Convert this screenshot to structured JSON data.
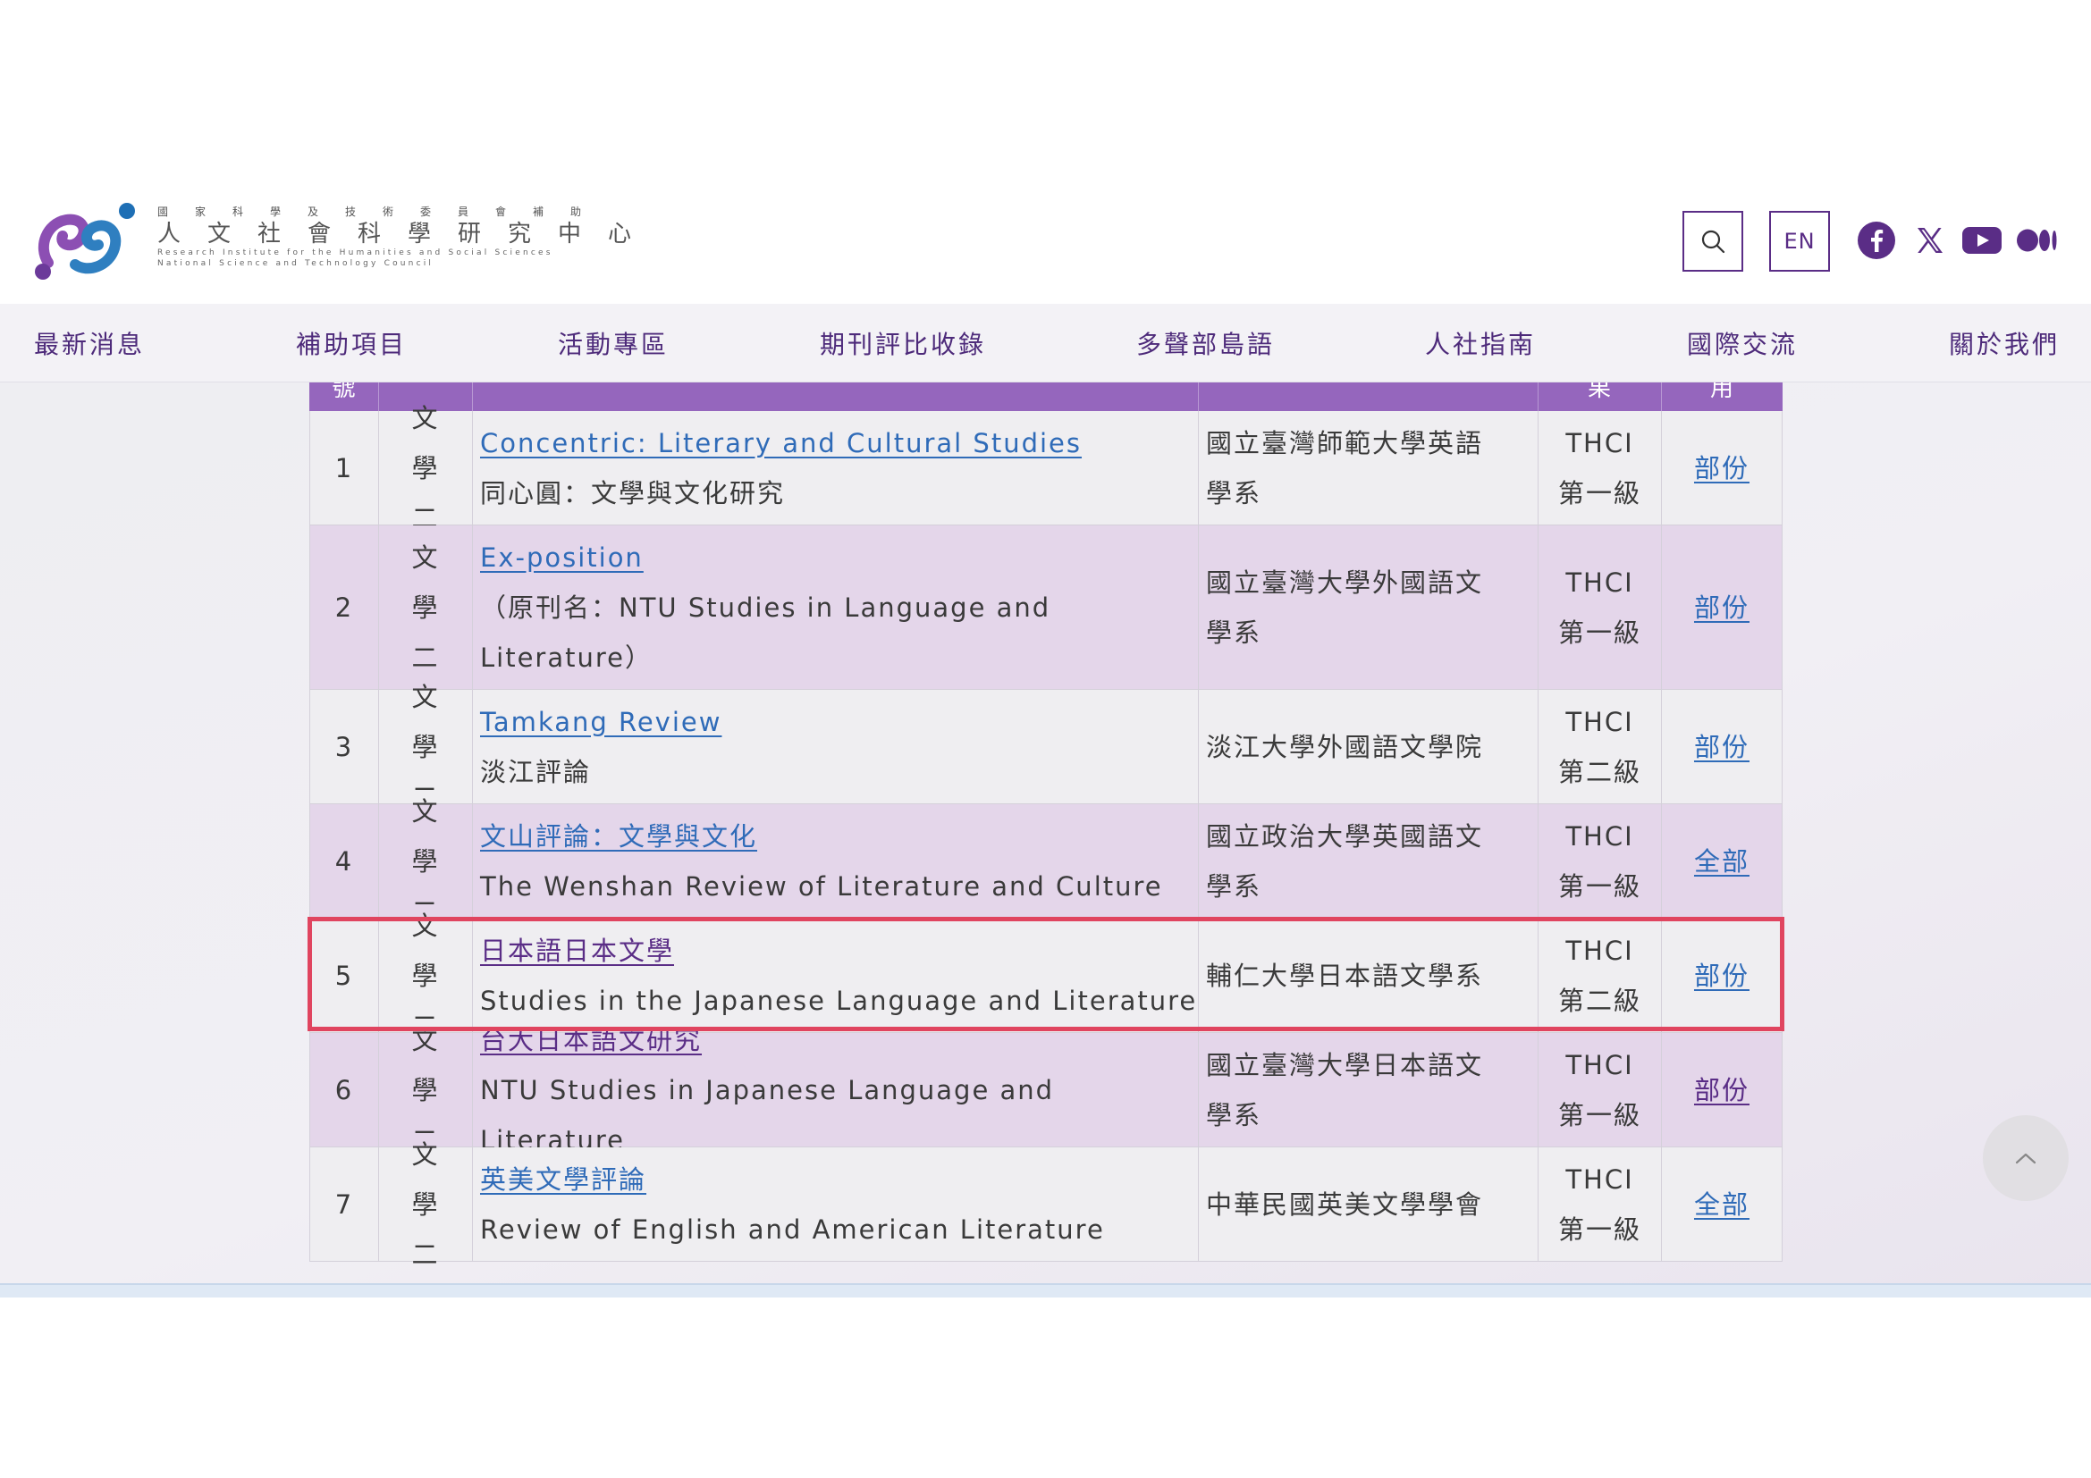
{
  "header": {
    "logo": {
      "line1": "國家科學及技術委員會補助",
      "line2": "人文社會科學研究中心",
      "line3": "Research Institute for the Humanities and Social Sciences",
      "line4": "National Science and Technology Council"
    },
    "search_icon": "search-icon",
    "lang_label": "EN",
    "social_icons": [
      "facebook-icon",
      "x-icon",
      "youtube-icon",
      "medium-icon"
    ]
  },
  "nav": {
    "items": [
      "最新消息",
      "補助項目",
      "活動專區",
      "期刊評比收錄",
      "多聲部島語",
      "人社指南",
      "國際交流",
      "關於我們"
    ]
  },
  "table": {
    "header_partial": [
      "號",
      "",
      "",
      "",
      "果",
      "用"
    ],
    "rows": [
      {
        "no": "1",
        "field": "文學二",
        "title": "Concentric: Literary and Cultural Studies",
        "subtitle": "同心圓：文學與文化研究",
        "org": "國立臺灣師範大學英語學系",
        "level_a": "THCI",
        "level_b": "第一級",
        "open": "部份"
      },
      {
        "no": "2",
        "field": "文學二",
        "title": "Ex-position",
        "subtitle": "（原刊名：NTU Studies in Language and Literature）",
        "org": "國立臺灣大學外國語文學系",
        "level_a": "THCI",
        "level_b": "第一級",
        "open": "部份"
      },
      {
        "no": "3",
        "field": "文學二",
        "title": "Tamkang Review",
        "subtitle": "淡江評論",
        "org": "淡江大學外國語文學院",
        "level_a": "THCI",
        "level_b": "第二級",
        "open": "部份"
      },
      {
        "no": "4",
        "field": "文學二",
        "title": "文山評論：文學與文化",
        "subtitle": "The Wenshan Review of Literature and Culture",
        "org": "國立政治大學英國語文學系",
        "level_a": "THCI",
        "level_b": "第一級",
        "open": "全部"
      },
      {
        "no": "5",
        "field": "文學二",
        "title": "日本語日本文學",
        "subtitle": "Studies in the Japanese Language and Literature",
        "org": "輔仁大學日本語文學系",
        "level_a": "THCI",
        "level_b": "第二級",
        "open": "部份"
      },
      {
        "no": "6",
        "field": "文學二",
        "title": "台大日本語文研究",
        "subtitle": "NTU Studies in Japanese Language and Literature",
        "org": "國立臺灣大學日本語文學系",
        "level_a": "THCI",
        "level_b": "第一級",
        "open": "部份"
      },
      {
        "no": "7",
        "field": "文學二",
        "title": "英美文學評論",
        "subtitle": "Review of English and American Literature",
        "org": "中華民國英美文學學會",
        "level_a": "THCI",
        "level_b": "第一級",
        "open": "全部"
      }
    ]
  },
  "back_to_top_icon": "chevron-up-icon",
  "colors": {
    "brand_purple": "#5a2d86",
    "table_header": "#9566bd",
    "row_alt": "#e4d6ea",
    "link": "#2f6bb8",
    "highlight": "#e0445f"
  }
}
